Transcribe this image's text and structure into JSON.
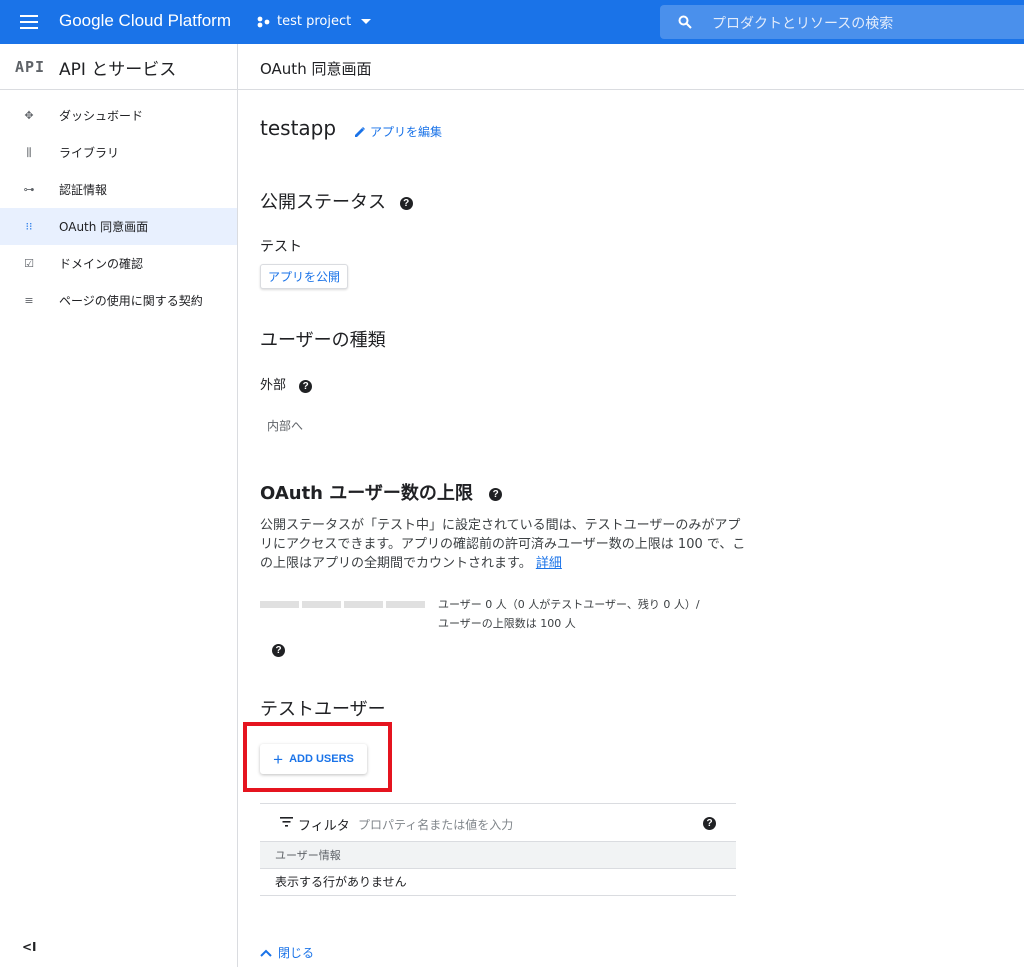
{
  "topbar": {
    "brand": "Google Cloud Platform",
    "project": "test project",
    "search_placeholder": "プロダクトとリソースの検索",
    "color": "#1a73e8"
  },
  "sidebar": {
    "badge": "API",
    "title": "API とサービス",
    "items": [
      {
        "label": "ダッシュボード",
        "icon": "dashboard-icon"
      },
      {
        "label": "ライブラリ",
        "icon": "library-icon"
      },
      {
        "label": "認証情報",
        "icon": "key-icon"
      },
      {
        "label": "OAuth 同意画面",
        "icon": "oauth-consent-icon",
        "active": true
      },
      {
        "label": "ドメインの確認",
        "icon": "checkbox-icon"
      },
      {
        "label": "ページの使用に関する契約",
        "icon": "settings-list-icon"
      }
    ],
    "collapse_label": "<I"
  },
  "page": {
    "title": "OAuth 同意画面"
  },
  "app": {
    "name": "testapp",
    "edit_label": "アプリを編集"
  },
  "publish_status": {
    "heading": "公開ステータス",
    "value": "テスト",
    "publish_button": "アプリを公開"
  },
  "user_type": {
    "heading": "ユーザーの種類",
    "value": "外部",
    "switch_button": "内部へ"
  },
  "user_cap": {
    "heading": "OAuth ユーザー数の上限",
    "description": "公開ステータスが「テスト中」に設定されている間は、テストユーザーのみがアプリにアクセスできます。アプリの確認前の許可済みユーザー数の上限は 100 で、この上限はアプリの全期間でカウントされます。",
    "details_link": "詳細",
    "progress_fraction": 0,
    "progress_line1": "ユーザー 0 人（0 人がテストユーザー、残り 0 人）/",
    "progress_line2": "ユーザーの上限数は 100 人"
  },
  "test_users": {
    "heading": "テストユーザー",
    "add_button": "ADD USERS",
    "filter_label": "フィルタ",
    "filter_placeholder": "プロパティ名または値を入力",
    "column_header": "ユーザー情報",
    "empty_message": "表示する行がありません"
  },
  "footer": {
    "close_label": "閉じる"
  },
  "highlight_color": "#e5141f"
}
